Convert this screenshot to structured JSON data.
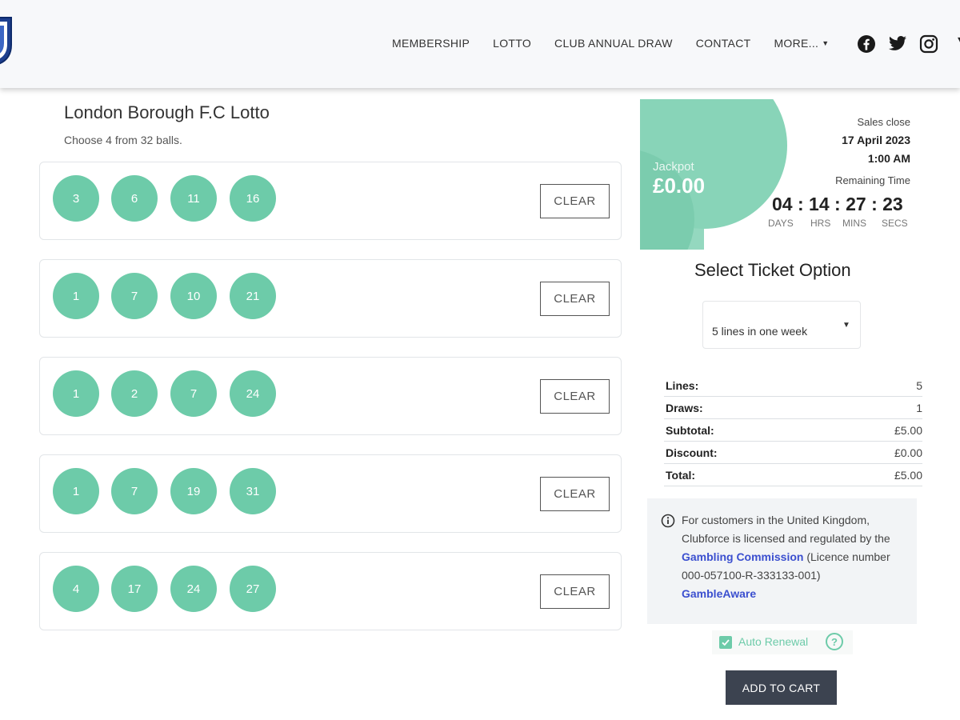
{
  "nav": {
    "items": [
      {
        "label": "MEMBERSHIP"
      },
      {
        "label": "LOTTO"
      },
      {
        "label": "CLUB ANNUAL DRAW"
      },
      {
        "label": "CONTACT"
      },
      {
        "label": "MORE..."
      }
    ],
    "social_icons": [
      "facebook-icon",
      "twitter-icon",
      "instagram-icon"
    ]
  },
  "lotto": {
    "title": "London Borough F.C Lotto",
    "subtitle": "Choose 4 from 32 balls.",
    "clear_label": "CLEAR",
    "lines": [
      {
        "numbers": [
          "3",
          "6",
          "11",
          "16"
        ]
      },
      {
        "numbers": [
          "1",
          "7",
          "10",
          "21"
        ]
      },
      {
        "numbers": [
          "1",
          "2",
          "7",
          "24"
        ]
      },
      {
        "numbers": [
          "1",
          "7",
          "19",
          "31"
        ]
      },
      {
        "numbers": [
          "4",
          "17",
          "24",
          "27"
        ]
      }
    ]
  },
  "jackpot": {
    "label": "Jackpot",
    "value": "£0.00",
    "sales_close_label": "Sales close",
    "sales_close_date": "17 April 2023",
    "sales_close_time": "1:00 AM",
    "remaining_label": "Remaining Time",
    "countdown": {
      "days": "04",
      "hrs": "14",
      "mins": "27",
      "secs": "23"
    },
    "units": {
      "days": "DAYS",
      "hrs": "HRS",
      "mins": "MINS",
      "secs": "SECS"
    }
  },
  "ticket": {
    "heading": "Select Ticket Option",
    "selected": "5 lines in one week"
  },
  "summary": [
    {
      "key": "Lines:",
      "value": "5"
    },
    {
      "key": "Draws:",
      "value": "1"
    },
    {
      "key": "Subtotal:",
      "value": "£5.00"
    },
    {
      "key": "Discount:",
      "value": "£0.00"
    },
    {
      "key": "Total:",
      "value": "£5.00"
    }
  ],
  "info": {
    "text_1": "For customers in the United Kingdom, Clubforce is licensed and regulated by the ",
    "link_1": "Gambling Commission",
    "text_2": " (Licence number 000-057100-R-333133-001)",
    "link_2": "GambleAware"
  },
  "auto_renewal": {
    "label": "Auto Renewal",
    "checked": true,
    "help": "?"
  },
  "add_to_cart": "ADD TO CART",
  "colors": {
    "accent": "#6dcba9",
    "jackpot_bg": "#88d4b8",
    "button_dark": "#3c4350",
    "link": "#3b4fcf"
  }
}
